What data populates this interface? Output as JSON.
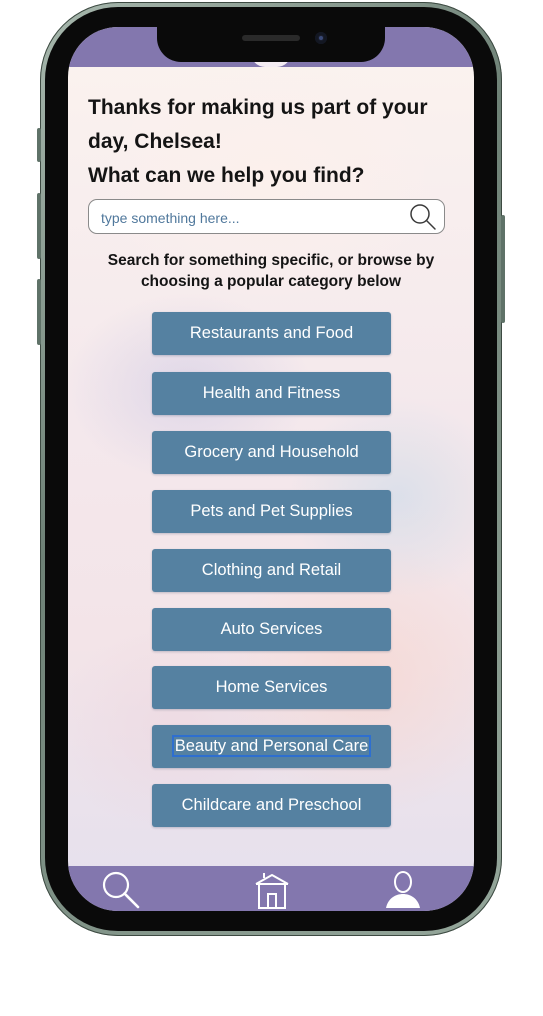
{
  "greeting": {
    "line1": "Thanks for making us part of your",
    "line2": "day, Chelsea!",
    "line3": "What can we help you find?"
  },
  "search": {
    "placeholder": "type something here...",
    "value": "",
    "icon": "search-icon"
  },
  "hint": {
    "line1": "Search for something specific, or browse by",
    "line2": "choosing a popular category below"
  },
  "categories": [
    {
      "label": "Restaurants and Food"
    },
    {
      "label": "Health and Fitness"
    },
    {
      "label": "Grocery and Household"
    },
    {
      "label": "Pets and Pet Supplies"
    },
    {
      "label": "Clothing and Retail"
    },
    {
      "label": "Auto Services"
    },
    {
      "label": "Home Services"
    },
    {
      "label": "Beauty and Personal Care",
      "focused": true
    },
    {
      "label": "Childcare and Preschool"
    }
  ],
  "tab_bar": {
    "items": [
      {
        "icon": "search-icon"
      },
      {
        "icon": "storefront-icon"
      },
      {
        "icon": "profile-icon"
      }
    ]
  },
  "colors": {
    "header_bar": "#8377ae",
    "button": "#5581a1",
    "button_text": "#ffffff",
    "focus_ring": "#2e6fd0"
  }
}
